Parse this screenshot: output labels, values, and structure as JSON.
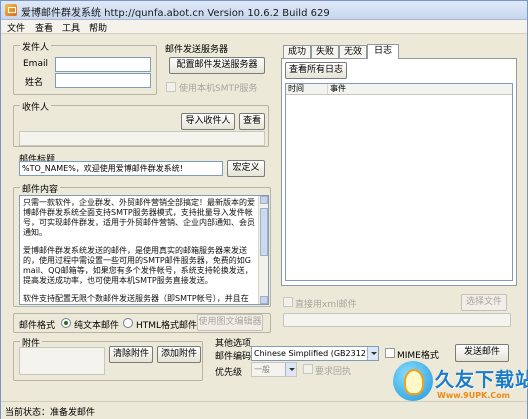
{
  "window": {
    "title": "爱博邮件群发系统 http://qunfa.abot.cn Version 10.6.2 Build 629"
  },
  "menu": [
    "文件",
    "查看",
    "工具",
    "帮助"
  ],
  "sender": {
    "group_label": "发件人",
    "email_label": "Email",
    "email_value": "",
    "name_label": "姓名",
    "name_value": ""
  },
  "server": {
    "group_label": "邮件发送服务器",
    "config_button": "配置邮件发送服务器",
    "use_local_smtp": "使用本机SMTP服务"
  },
  "recipients": {
    "group_label": "收件人",
    "import_button": "导入收件人",
    "view_button": "查看",
    "value": ""
  },
  "subject": {
    "group_label": "邮件标题",
    "value": "%TO_NAME%，欢迎使用爱博邮件群发系统!",
    "macro_button": "宏定义"
  },
  "content": {
    "group_label": "邮件内容",
    "paragraphs": [
      "只需一款软件，企业群发、外贸邮件营销全部搞定！最新版本的爱博邮件群发系统全面支持SMTP服务器模式，支持批量导入发件帐号，可实现邮件群发，适用于外贸邮件营销、企业内部通知、会员通知。",
      "爱博邮件群发系统发送的邮件，是使用真实的邮箱服务器来发送的，使用过程中需设置一些可用的SMTP邮件服务器，免费的如Gmail、QQ邮箱等，如果您有多个发件帐号，系统支持轮换发送，提高发送成功率，也可使用本机SMTP服务直接发送。",
      "软件支持配置无限个数邮件发送服务器（即SMTP帐号），并且在"
    ]
  },
  "format": {
    "group_label": "邮件格式",
    "plain_label": "纯文本邮件",
    "html_label": "HTML格式邮件",
    "plain_selected": true,
    "editor_button": "使用图文编辑器"
  },
  "attachment": {
    "group_label": "附件",
    "clear_button": "清除附件",
    "add_button": "添加附件"
  },
  "other": {
    "group_label": "其他选项",
    "encoding_label": "邮件编码",
    "encoding_value": "Chinese Simplified (GB2312)",
    "mime_label": "MIME格式",
    "priority_label": "优先级",
    "priority_value": "一般",
    "receipt_label": "要求回执"
  },
  "send_button": "发送邮件",
  "log": {
    "tabs": [
      "成功",
      "失败",
      "无效",
      "日志"
    ],
    "active_tab": "日志",
    "view_all_button": "查看所有日志",
    "columns": [
      "时间",
      "事件"
    ],
    "use_xml_label": "直接用xml邮件",
    "select_file_button": "选择文件"
  },
  "status": {
    "label": "当前状态：准备发邮件"
  },
  "watermark": {
    "name": "久友下载站",
    "url": "Www.9UPK.Com"
  }
}
